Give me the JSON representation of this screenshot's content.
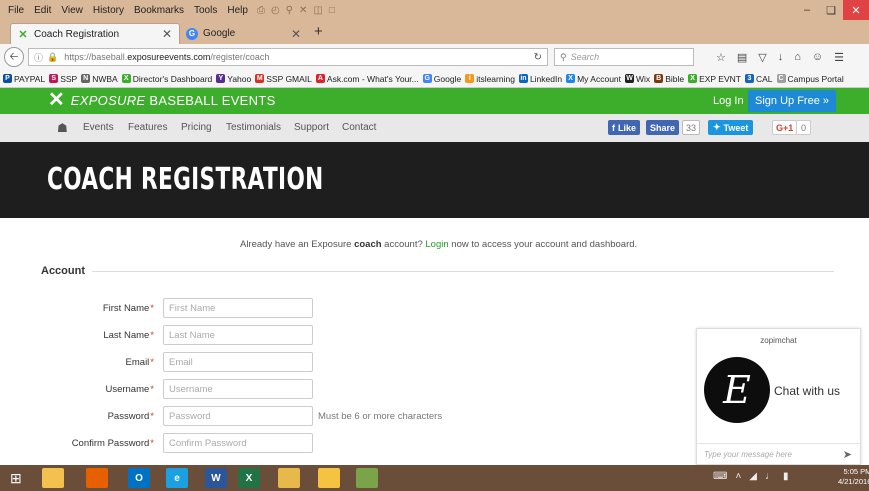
{
  "menubar": {
    "items": [
      "File",
      "Edit",
      "View",
      "History",
      "Bookmarks",
      "Tools",
      "Help"
    ]
  },
  "tabs": [
    {
      "label": "Coach Registration",
      "icon": "exposure-x-icon"
    },
    {
      "label": "Google",
      "icon": "google-icon"
    }
  ],
  "navbar": {
    "url_prefix": "https://baseball.",
    "url_host": "exposureevents.com",
    "url_path": "/register/coach",
    "search_placeholder": "Search"
  },
  "bookmarks": [
    {
      "label": "PAYPAL",
      "color": "#0b4fa3",
      "glyph": "P"
    },
    {
      "label": "SSP",
      "color": "#c2185b",
      "glyph": "S"
    },
    {
      "label": "NWBA",
      "color": "#666666",
      "glyph": "N"
    },
    {
      "label": "Director's Dashboard",
      "color": "#3dae2b",
      "glyph": "X"
    },
    {
      "label": "Yahoo",
      "color": "#5c2d91",
      "glyph": "Y"
    },
    {
      "label": "SSP GMAIL",
      "color": "#d93025",
      "glyph": "M"
    },
    {
      "label": "Ask.com - What's Your...",
      "color": "#d9242b",
      "glyph": "A"
    },
    {
      "label": "Google",
      "color": "#4285f4",
      "glyph": "G"
    },
    {
      "label": "itslearning",
      "color": "#f29a1e",
      "glyph": "i"
    },
    {
      "label": "LinkedIn",
      "color": "#0a66c2",
      "glyph": "in"
    },
    {
      "label": "My Account",
      "color": "#1e88e5",
      "glyph": "X"
    },
    {
      "label": "Wix",
      "color": "#222222",
      "glyph": "W"
    },
    {
      "label": "Bible",
      "color": "#7a3b12",
      "glyph": "B"
    },
    {
      "label": "EXP EVNT",
      "color": "#3dae2b",
      "glyph": "X"
    },
    {
      "label": "CAL",
      "color": "#1565c0",
      "glyph": "3"
    },
    {
      "label": "Campus Portal",
      "color": "#9e9e9e",
      "glyph": "C"
    }
  ],
  "site": {
    "logo_italic": "EXPOSURE",
    "logo_rest": "BASEBALL EVENTS",
    "login_label": "Log In",
    "signup_label": "Sign Up Free »",
    "nav": [
      "Events",
      "Features",
      "Pricing",
      "Testimonials",
      "Support",
      "Contact"
    ],
    "social": {
      "like_label": "Like",
      "share_label": "Share",
      "share_count": "33",
      "tweet_label": "Tweet",
      "gplus_label": "G+1",
      "gplus_count": "0"
    },
    "hero_title": "COACH REGISTRATION"
  },
  "content": {
    "intro_pre": "Already have an Exposure ",
    "intro_bold": "coach",
    "intro_mid": " account? ",
    "intro_link": "Login",
    "intro_post": " now to access your account and dashboard.",
    "section_title": "Account",
    "required_mark": "*",
    "fields": [
      {
        "label": "First Name",
        "placeholder": "First Name",
        "hint": ""
      },
      {
        "label": "Last Name",
        "placeholder": "Last Name",
        "hint": ""
      },
      {
        "label": "Email",
        "placeholder": "Email",
        "hint": ""
      },
      {
        "label": "Username",
        "placeholder": "Username",
        "hint": ""
      },
      {
        "label": "Password",
        "placeholder": "Password",
        "hint": "Must be 6 or more characters"
      },
      {
        "label": "Confirm Password",
        "placeholder": "Confirm Password",
        "hint": ""
      }
    ]
  },
  "chat": {
    "brand": "zopimchat",
    "avatar_letter": "E",
    "cta": "Chat with us",
    "input_placeholder": "Type your message here"
  },
  "taskbar": {
    "apps": [
      {
        "name": "file-explorer-icon",
        "color": "#f2c14e",
        "glyph": ""
      },
      {
        "name": "firefox-icon",
        "color": "#e66000",
        "glyph": ""
      },
      {
        "name": "outlook-icon",
        "color": "#0072c6",
        "glyph": "O"
      },
      {
        "name": "internet-explorer-icon",
        "color": "#1ba1e2",
        "glyph": "e"
      },
      {
        "name": "word-icon",
        "color": "#2b579a",
        "glyph": "W"
      },
      {
        "name": "excel-icon",
        "color": "#217346",
        "glyph": "X"
      },
      {
        "name": "files-icon",
        "color": "#e7b84a",
        "glyph": ""
      },
      {
        "name": "folder-icon",
        "color": "#f5c342",
        "glyph": ""
      },
      {
        "name": "paint-icon",
        "color": "#7aa34a",
        "glyph": ""
      }
    ],
    "time": "5:05 PM",
    "date": "4/21/2016"
  }
}
